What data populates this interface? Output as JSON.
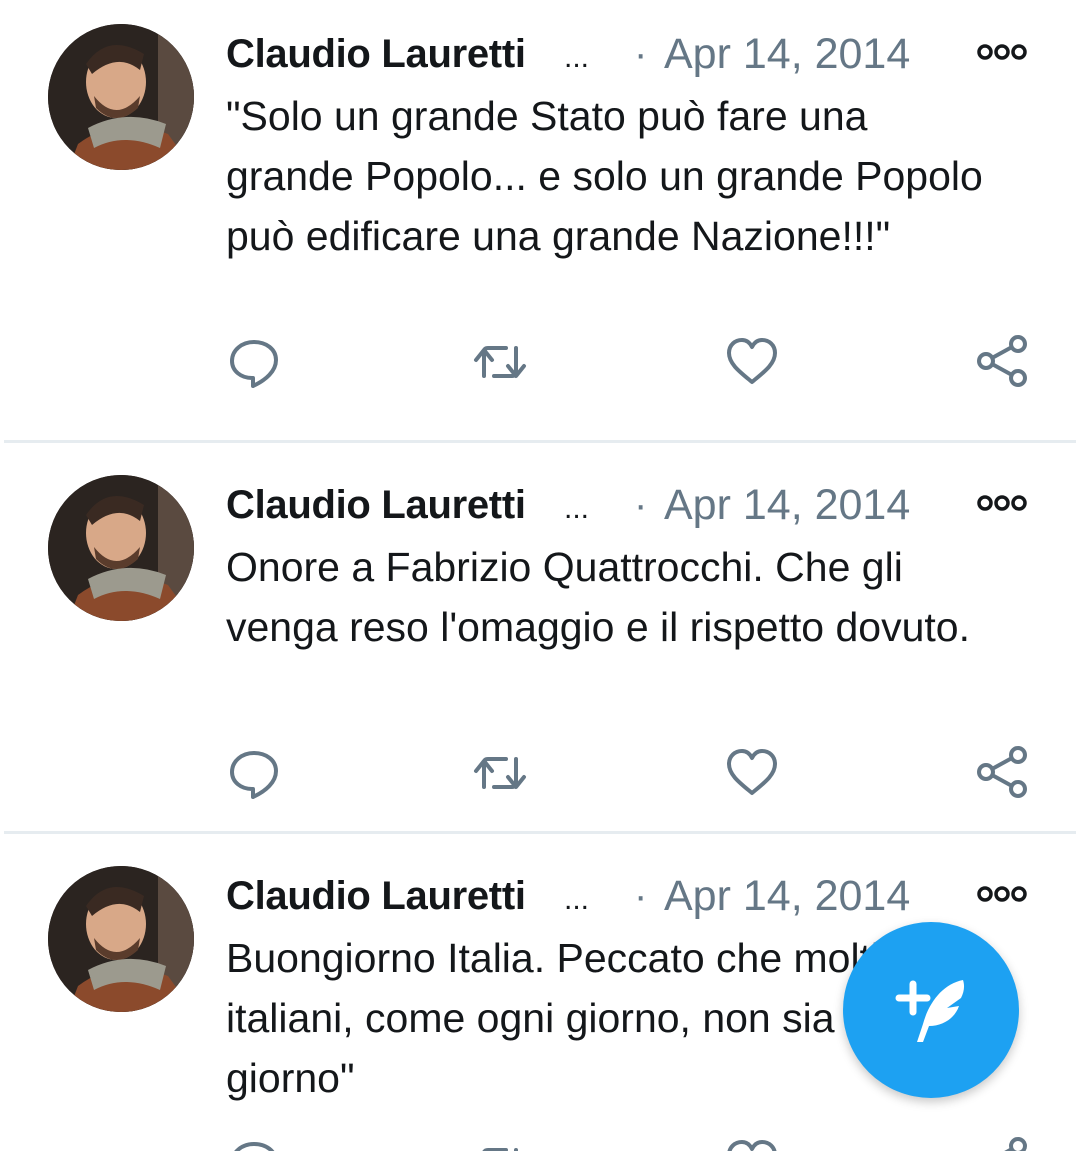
{
  "tweets": [
    {
      "author": "Claudio Lauretti",
      "ellipsis": "...",
      "separator": "·",
      "date": "Apr 14, 2014",
      "text": "\"Solo un grande Stato può fare una grande Popolo... e solo un grande Popolo può edificare una grande Nazione!!!\""
    },
    {
      "author": "Claudio Lauretti",
      "ellipsis": "...",
      "separator": "·",
      "date": "Apr 14, 2014",
      "text": "Onore a Fabrizio Quattrocchi. Che gli venga reso l'omaggio e il rispetto dovuto."
    },
    {
      "author": "Claudio Lauretti",
      "ellipsis": "...",
      "separator": "·",
      "date": "Apr 14, 2014",
      "text": "Buongiorno Italia. Peccato che molti italiani, come ogni giorno, non sia \"buon giorno\""
    }
  ],
  "icons": {
    "more": "more-options-icon",
    "reply": "reply-icon",
    "retweet": "retweet-icon",
    "like": "heart-icon",
    "share": "share-icon",
    "compose": "compose-tweet-icon"
  },
  "colors": {
    "accent": "#1da1f2",
    "secondary_text": "#657786",
    "icon": "#657786",
    "divider": "#e6ecf0"
  }
}
